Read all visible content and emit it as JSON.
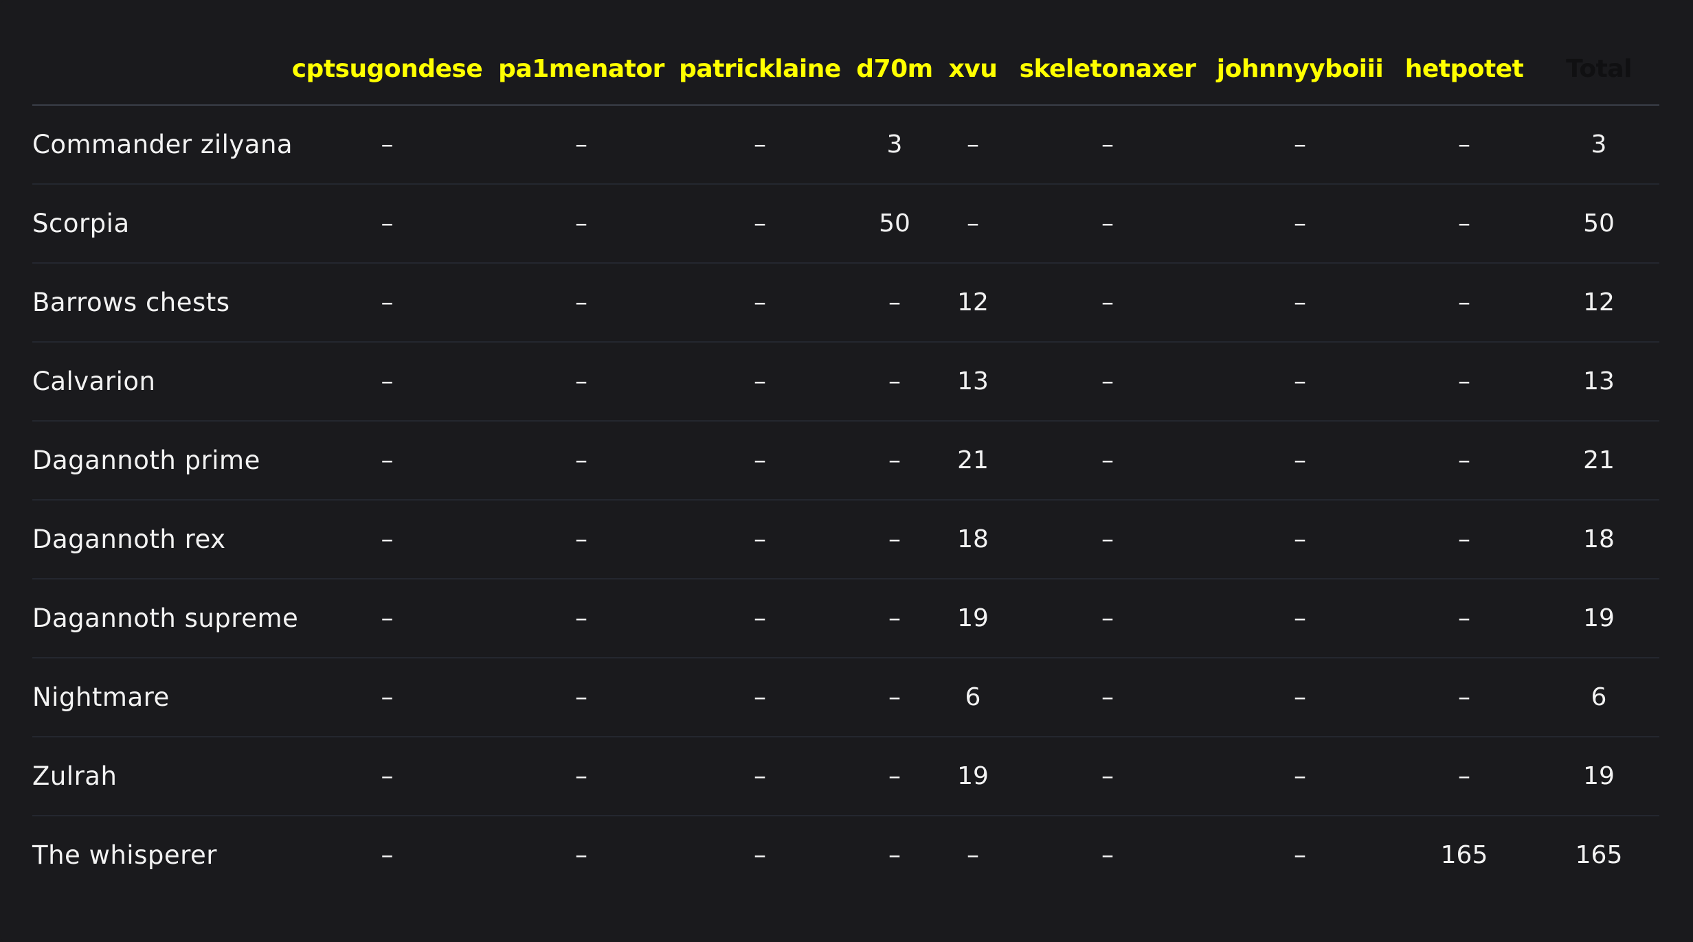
{
  "table": {
    "corner": "",
    "columns": [
      "cptsugondese",
      "pa1menator",
      "patricklaine",
      "d70m",
      "xvu",
      "skeletonaxer",
      "johnnyyboiii",
      "hetpotet",
      "Total"
    ],
    "rows": [
      {
        "boss": "Commander zilyana",
        "cells": [
          "–",
          "–",
          "–",
          "3",
          "–",
          "–",
          "–",
          "–",
          "3"
        ]
      },
      {
        "boss": "Scorpia",
        "cells": [
          "–",
          "–",
          "–",
          "50",
          "–",
          "–",
          "–",
          "–",
          "50"
        ]
      },
      {
        "boss": "Barrows chests",
        "cells": [
          "–",
          "–",
          "–",
          "–",
          "12",
          "–",
          "–",
          "–",
          "12"
        ]
      },
      {
        "boss": "Calvarion",
        "cells": [
          "–",
          "–",
          "–",
          "–",
          "13",
          "–",
          "–",
          "–",
          "13"
        ]
      },
      {
        "boss": "Dagannoth prime",
        "cells": [
          "–",
          "–",
          "–",
          "–",
          "21",
          "–",
          "–",
          "–",
          "21"
        ]
      },
      {
        "boss": "Dagannoth rex",
        "cells": [
          "–",
          "–",
          "–",
          "–",
          "18",
          "–",
          "–",
          "–",
          "18"
        ]
      },
      {
        "boss": "Dagannoth supreme",
        "cells": [
          "–",
          "–",
          "–",
          "–",
          "19",
          "–",
          "–",
          "–",
          "19"
        ]
      },
      {
        "boss": "Nightmare",
        "cells": [
          "–",
          "–",
          "–",
          "–",
          "6",
          "–",
          "–",
          "–",
          "6"
        ]
      },
      {
        "boss": "Zulrah",
        "cells": [
          "–",
          "–",
          "–",
          "–",
          "19",
          "–",
          "–",
          "–",
          "19"
        ]
      },
      {
        "boss": "The whisperer",
        "cells": [
          "–",
          "–",
          "–",
          "–",
          "–",
          "–",
          "–",
          "165",
          "165"
        ]
      }
    ]
  },
  "colors": {
    "background": "#1a1a1d",
    "header_text": "#ffff00",
    "cell_text": "#f2f2f2",
    "total_header_text": "#101012"
  }
}
